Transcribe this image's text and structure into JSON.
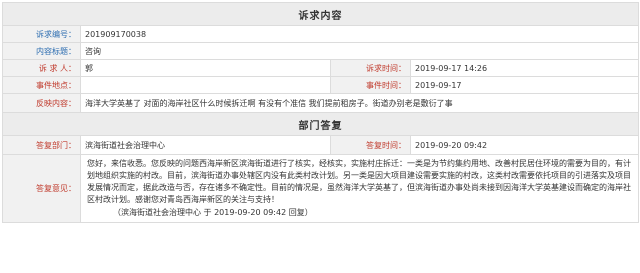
{
  "petition": {
    "section_title": "诉求内容",
    "fields": {
      "number": {
        "label": "诉求编号：",
        "value": "201909170038"
      },
      "title": {
        "label": "内容标题：",
        "value": "咨询"
      },
      "petitioner": {
        "label": "诉 求 人：",
        "value": "郭"
      },
      "petition_time": {
        "label": "诉求时间：",
        "value": "2019-09-17 14:26"
      },
      "location": {
        "label": "事件地点：",
        "value": ""
      },
      "event_time": {
        "label": "事件时间：",
        "value": "2019-09-17"
      },
      "content": {
        "label": "反映内容：",
        "value": "海洋大学英基了 对面的海岸社区什么时候拆迁啊 有没有个准信 我们提前租房子。街道办别老是敷衍了事"
      }
    }
  },
  "reply": {
    "section_title": "部门答复",
    "fields": {
      "department": {
        "label": "答复部门：",
        "value": "滨海街道社会治理中心"
      },
      "reply_time": {
        "label": "答复时间：",
        "value": "2019-09-20 09:42"
      },
      "opinion": {
        "label": "答复意见：",
        "body": "您好，来信收悉。您反映的问题西海岸新区滨海街道进行了核实，经核实，实施村庄拆迁：一类是为节约集约用地、改善村民居住环境的需要为目的，有计划地组织实施的村改。目前，滨海街道办事处辖区内没有此类村改计划。另一类是因大项目建设需要实施的村改，这类村改需要依托项目的引进落实及项目发展情况而定，据此改造与否，存在诸多不确定性。目前的情况是，虽然海洋大学英基了，但滨海街道办事处尚未接到因海洋大学英基建设而确定的海岸社区村改计划。感谢您对青岛西海岸新区的关注与支持！",
        "signature": "（滨海街道社会治理中心 于 2019-09-20 09:42 回复）"
      }
    }
  }
}
